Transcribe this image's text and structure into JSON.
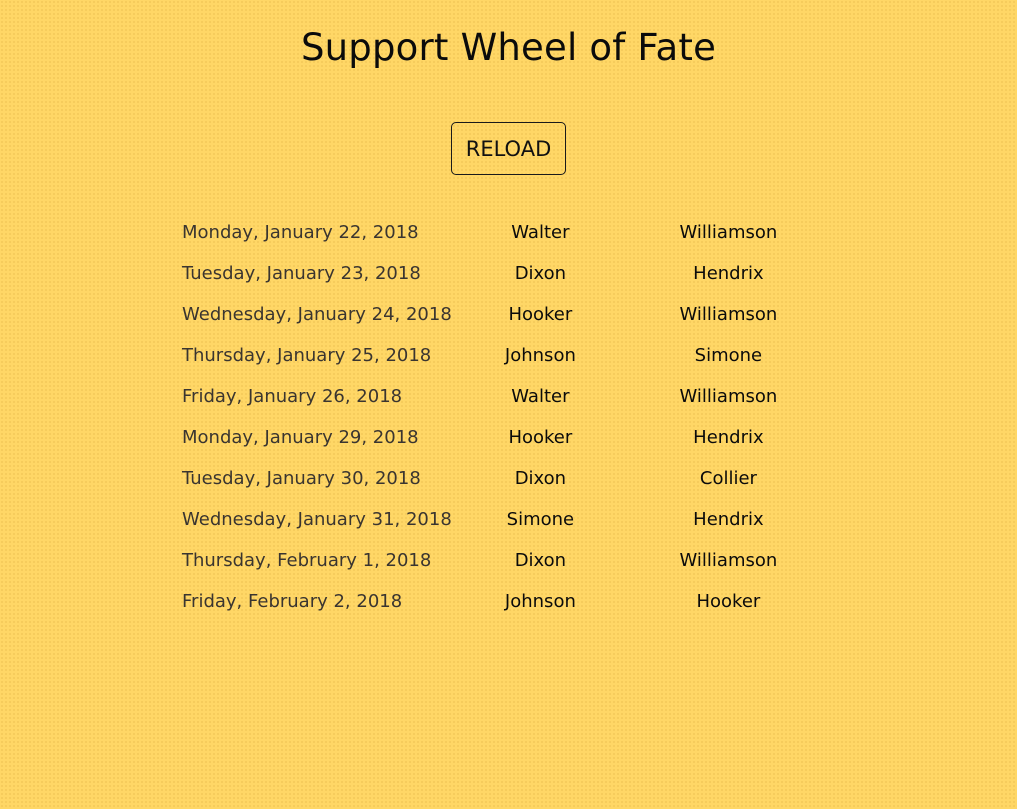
{
  "header": {
    "title": "Support Wheel of Fate"
  },
  "controls": {
    "reload_label": "RELOAD"
  },
  "schedule": [
    {
      "date": "Monday, January 22, 2018",
      "first": "Walter",
      "second": "Williamson"
    },
    {
      "date": "Tuesday, January 23, 2018",
      "first": "Dixon",
      "second": "Hendrix"
    },
    {
      "date": "Wednesday, January 24, 2018",
      "first": "Hooker",
      "second": "Williamson"
    },
    {
      "date": "Thursday, January 25, 2018",
      "first": "Johnson",
      "second": "Simone"
    },
    {
      "date": "Friday, January 26, 2018",
      "first": "Walter",
      "second": "Williamson"
    },
    {
      "date": "Monday, January 29, 2018",
      "first": "Hooker",
      "second": "Hendrix"
    },
    {
      "date": "Tuesday, January 30, 2018",
      "first": "Dixon",
      "second": "Collier"
    },
    {
      "date": "Wednesday, January 31, 2018",
      "first": "Simone",
      "second": "Hendrix"
    },
    {
      "date": "Thursday, February 1, 2018",
      "first": "Dixon",
      "second": "Williamson"
    },
    {
      "date": "Friday, February 2, 2018",
      "first": "Johnson",
      "second": "Hooker"
    }
  ],
  "colors": {
    "background": "#ffd766",
    "text": "#0b0b0b",
    "date_text": "#3a3530",
    "button_border": "#1a1a1a"
  }
}
